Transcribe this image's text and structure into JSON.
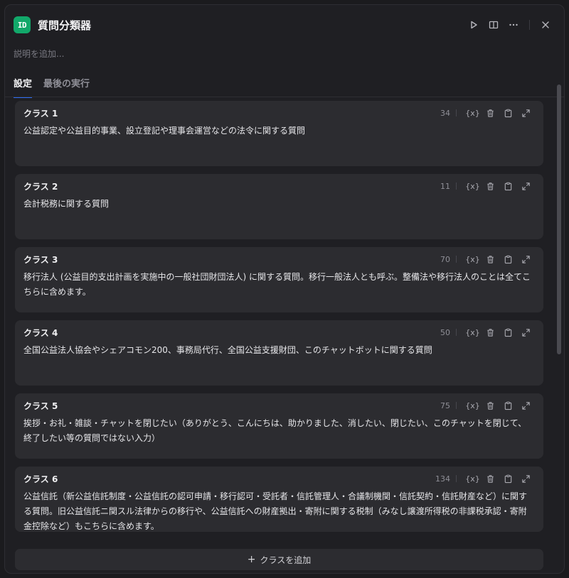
{
  "header": {
    "app_icon_text": "ID",
    "title": "質問分類器",
    "description_placeholder": "説明を追加..."
  },
  "tabs": [
    {
      "label": "設定",
      "active": true
    },
    {
      "label": "最後の実行",
      "active": false
    }
  ],
  "classes": [
    {
      "name": "クラス 1",
      "count": "34",
      "text": "公益認定や公益目的事業、設立登記や理事会運営などの法令に関する質問"
    },
    {
      "name": "クラス 2",
      "count": "11",
      "text": "会計税務に関する質問"
    },
    {
      "name": "クラス 3",
      "count": "70",
      "text": "移行法人 (公益目的支出計画を実施中の一般社団財団法人) に関する質問。移行一般法人とも呼ぶ。整備法や移行法人のことは全てこちらに含めます。"
    },
    {
      "name": "クラス 4",
      "count": "50",
      "text": "全国公益法人協会やシェアコモン200、事務局代行、全国公益支援財団、このチャットボットに関する質問"
    },
    {
      "name": "クラス 5",
      "count": "75",
      "text": "挨拶・お礼・雑談・チャットを閉じたい（ありがとう、こんにちは、助かりました、消したい、閉じたい、このチャットを閉じて、終了したい等の質問ではない入力）"
    },
    {
      "name": "クラス 6",
      "count": "134",
      "text": "公益信託（新公益信託制度・公益信託の認可申請・移行認可・受託者・信託管理人・合議制機関・信託契約・信託財産など）に関する質問。旧公益信託ニ関スル法律からの移行や、公益信託への財産拠出・寄附に関する税制（みなし譲渡所得税の非課税承認・寄附金控除など）もこちらに含めます。"
    }
  ],
  "variable_tool_label": "{x}",
  "add_button": {
    "label": "クラスを追加",
    "icon": "+"
  },
  "colors": {
    "accent": "#2f6df5",
    "app_icon": "#12a86a"
  }
}
